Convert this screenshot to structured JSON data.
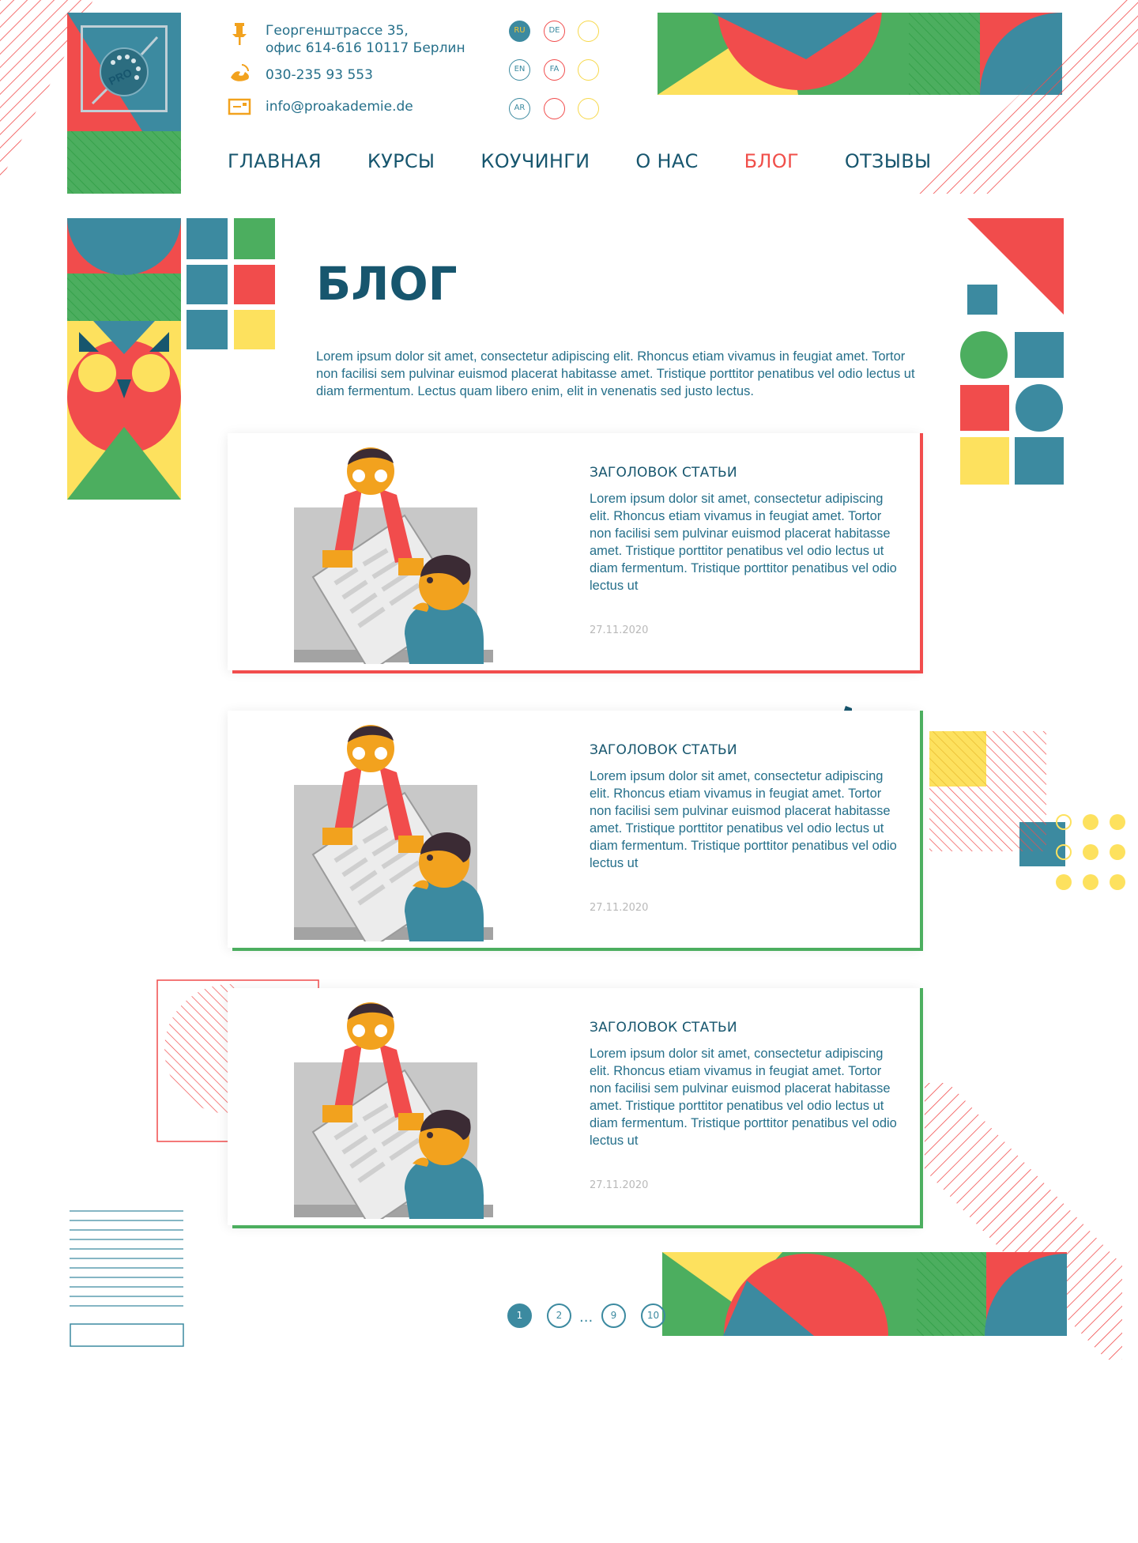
{
  "header": {
    "address_line1": "Георгенштрассе 35,",
    "address_line2": "офис 614-616 10117 Берлин",
    "phone": "030-235 93 553",
    "email": "info@proakademie.de",
    "logo_text": "PRO",
    "languages": [
      "RU",
      "DE",
      "EN",
      "FA",
      "AR"
    ]
  },
  "nav": {
    "items": [
      {
        "label": "ГЛАВНАЯ"
      },
      {
        "label": "КУРСЫ"
      },
      {
        "label": "КОУЧИНГИ"
      },
      {
        "label": "О НАС"
      },
      {
        "label": "БЛОГ",
        "active": true
      },
      {
        "label": "ОТЗЫВЫ"
      }
    ]
  },
  "page": {
    "title": "БЛОГ",
    "intro": "Lorem ipsum dolor sit amet, consectetur adipiscing elit. Rhoncus etiam vivamus in feugiat amet. Tortor non facilisi sem pulvinar euismod placerat habitasse amet. Tristique porttitor penatibus vel odio lectus ut diam fermentum. Lectus quam libero enim, elit in venenatis sed justo lectus."
  },
  "articles": [
    {
      "title": "ЗАГОЛОВОК СТАТЬИ",
      "text": "Lorem ipsum dolor sit amet, consectetur adipiscing elit. Rhoncus etiam vivamus in feugiat amet. Tortor non facilisi sem pulvinar euismod placerat habitasse amet. Tristique porttitor penatibus vel odio lectus ut diam fermentum. Tristique porttitor penatibus vel odio lectus ut",
      "date": "27.11.2020",
      "accent_color": "#f14c4c"
    },
    {
      "title": "ЗАГОЛОВОК СТАТЬИ",
      "text": "Lorem ipsum dolor sit amet, consectetur adipiscing elit. Rhoncus etiam vivamus in feugiat amet. Tortor non facilisi sem pulvinar euismod placerat habitasse amet. Tristique porttitor penatibus vel odio lectus ut diam fermentum. Tristique porttitor penatibus vel odio lectus ut",
      "date": "27.11.2020",
      "accent_color": "#4cae5f"
    },
    {
      "title": "ЗАГОЛОВОК СТАТЬИ",
      "text": "Lorem ipsum dolor sit amet, consectetur adipiscing elit. Rhoncus etiam vivamus in feugiat amet. Tortor non facilisi sem pulvinar euismod placerat habitasse amet. Tristique porttitor penatibus vel odio lectus ut diam fermentum. Tristique porttitor penatibus vel odio lectus ut",
      "date": "27.11.2020",
      "accent_color": "#4cae5f"
    }
  ],
  "pagination": {
    "pages": [
      "1",
      "2",
      "9",
      "10"
    ],
    "current": "1",
    "ellipsis": "..."
  },
  "colors": {
    "teal": "#3c8aa0",
    "dark_teal": "#17566e",
    "red": "#f14c4c",
    "green": "#4cae5f",
    "yellow": "#fde15e",
    "orange": "#f2a21e"
  },
  "icons": [
    "pin-icon",
    "phone-icon",
    "mail-icon",
    "logo-icon"
  ]
}
